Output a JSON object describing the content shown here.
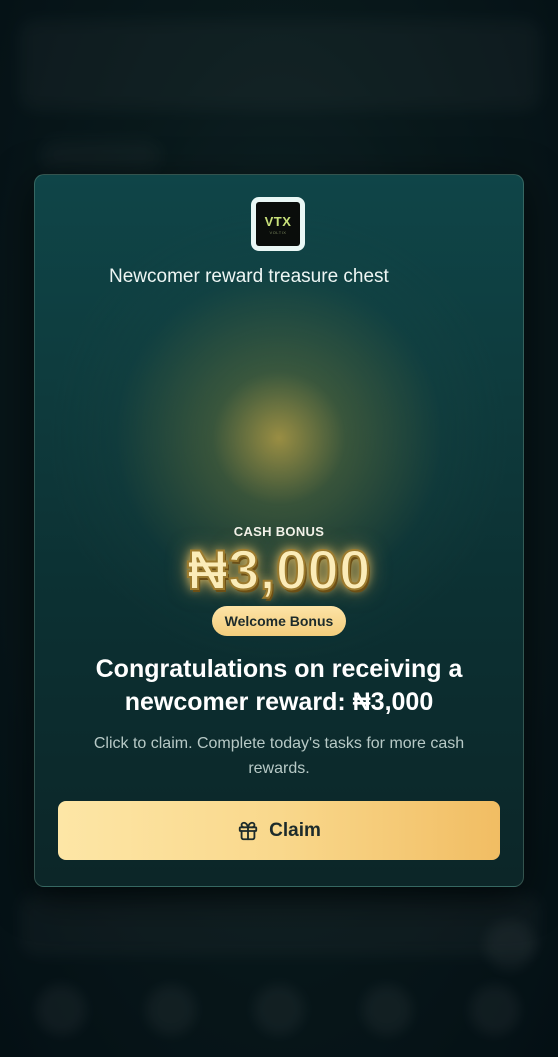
{
  "modal": {
    "logo_text": "VTX",
    "logo_sub": "VOLTIX",
    "title": "Newcomer reward treasure chest",
    "cash_label": "CASH BONUS",
    "amount": "₦3,000",
    "badge": "Welcome Bonus",
    "headline": "Congratulations on receiving a newcomer reward: ₦3,000",
    "description": "Click to claim. Complete today's tasks for more cash rewards.",
    "claim_label": "Claim",
    "claim_icon": "gift-icon"
  },
  "colors": {
    "accent_gold": "#f9d88c",
    "card_teal": "#0e3b3d",
    "text_dark": "#1d2b2b"
  }
}
